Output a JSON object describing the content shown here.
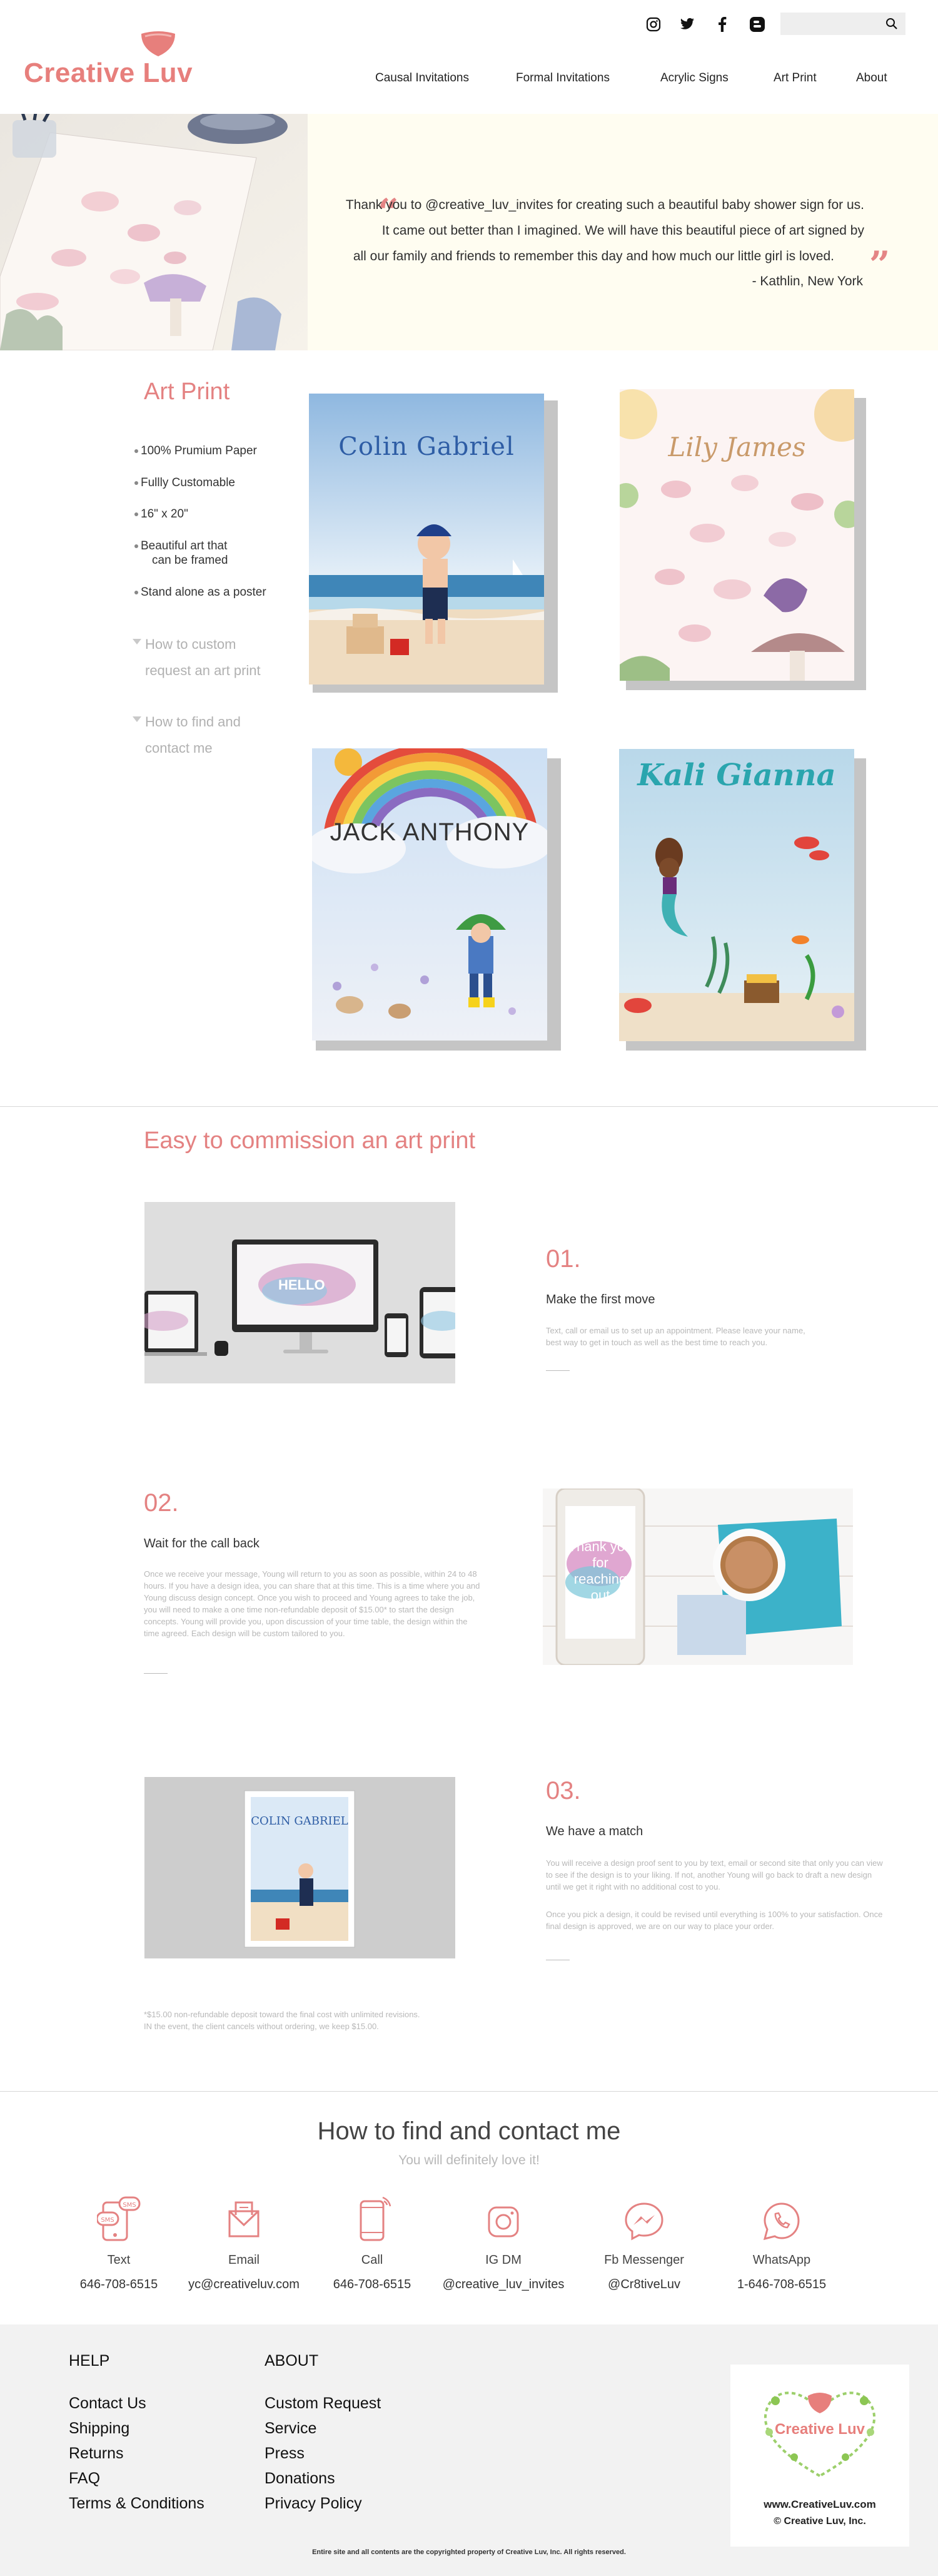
{
  "header": {
    "logo_text": "Creative Luv",
    "nav": [
      "Causal Invitations",
      "Formal Invitations",
      "Acrylic Signs",
      "Art Print",
      "About"
    ],
    "social_icons": [
      "instagram-icon",
      "twitter-icon",
      "facebook-icon",
      "blogger-icon"
    ],
    "search_placeholder": ""
  },
  "testimonial": {
    "lines": [
      "Thank you to @creative_luv_invites for creating such a beautiful baby shower sign for us.",
      "It came out better than I imagined. We will have this beautiful piece of art signed by",
      "all our family and friends to remember this day and how much our little girl is loved."
    ],
    "author": "- Kathlin, New York",
    "open_quote": "“",
    "close_quote": "”"
  },
  "art_print": {
    "title": "Art Print",
    "features": [
      "100% Prumium Paper",
      "Fullly Customable",
      "16\" x 20\"",
      "Beautiful art that",
      "can be framed",
      "Stand alone as a poster"
    ],
    "toggles": [
      [
        "How to custom",
        "request an art print"
      ],
      [
        "How to find and",
        "contact me"
      ]
    ],
    "prints": [
      "Colin Gabriel",
      "Lily James",
      "JACK ANTHONY",
      "Kali Gianna"
    ]
  },
  "commission": {
    "title": "Easy to commission an art print",
    "steps": [
      {
        "num": "01.",
        "title": "Make the first move",
        "body": "Text, call or email us to set up an appointment. Please leave your name, best way to get in touch as well as the best time to reach you."
      },
      {
        "num": "02.",
        "title": "Wait for the call back",
        "body": "Once we receive your message, Young will return to you as soon as possible, within 24 to 48 hours. If you have a design idea, you can share that at this time. This is a time where you and Young discuss design concept. Once you wish to proceed and Young agrees to take the job, you will need to make a one time non-refundable deposit of $15.00* to start the design concepts. Young will provide you, upon discussion of your time table, the design within the time agreed. Each design will be custom tailored to you."
      },
      {
        "num": "03.",
        "title": "We have a match",
        "body": "You will receive a design proof sent to you by text, email or second site that only you can view to see if the design is to your liking. If not, another Young will go back to draft a new design until we get it right with no additional cost to you.",
        "body2": "Once you pick a design, it could be revised until everything is 100% to your satisfaction. Once final design is approved, we are on our way to place your order."
      }
    ],
    "screen_hello": "HELLO",
    "tablet_text": [
      "Thank you",
      "for",
      "reaching out"
    ],
    "canvas_title": "COLIN GABRIEL",
    "footnote": [
      "*$15.00 non-refundable deposit toward the final cost with unlimited revisions.",
      "IN the event, the client cancels without ordering, we keep $15.00."
    ]
  },
  "contact": {
    "title": "How to find and contact me",
    "subtitle": "You will definitely love it!",
    "items": [
      {
        "icon": "sms-icon",
        "label": "Text",
        "value": "646-708-6515"
      },
      {
        "icon": "email-icon",
        "label": "Email",
        "value": "yc@creativeluv.com"
      },
      {
        "icon": "phone-icon",
        "label": "Call",
        "value": "646-708-6515"
      },
      {
        "icon": "instagram-icon",
        "label": "IG DM",
        "value": "@creative_luv_invites"
      },
      {
        "icon": "messenger-icon",
        "label": "Fb Messenger",
        "value": "@Cr8tiveLuv"
      },
      {
        "icon": "whatsapp-icon",
        "label": "WhatsApp",
        "value": "1-646-708-6515"
      }
    ]
  },
  "footer": {
    "help_title": "HELP",
    "help_links": [
      "Contact Us",
      "Shipping",
      "Returns",
      "FAQ",
      "Terms & Conditions"
    ],
    "about_title": "ABOUT",
    "about_links": [
      "Custom Request",
      "Service",
      "Press",
      "Donations",
      "Privacy Policy"
    ],
    "card_logo": "Creative Luv",
    "card_site": "www.CreativeLuv.com",
    "card_copy": "© Creative Luv, Inc.",
    "copyright": "Entire site and all contents are the copyrighted property of Creative Luv, Inc. All rights reserved."
  },
  "colors": {
    "accent": "#e48282",
    "cream": "#fffdf1",
    "footer_bg": "#f2f2f2"
  }
}
